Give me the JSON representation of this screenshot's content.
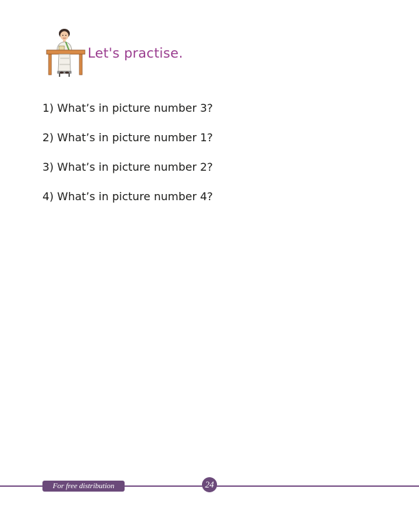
{
  "header": {
    "title": "Let's practise.",
    "illustration": "teacher-at-desk-icon",
    "title_color": "#9a3d8f"
  },
  "questions": [
    "1) What’s in picture number 3?",
    "2) What’s in picture number 1?",
    "3) What’s in picture number 2?",
    "4) What’s in picture number 4?"
  ],
  "footer": {
    "tag": "For free distribution",
    "page_number": "24",
    "accent_color": "#6b4a7a"
  }
}
